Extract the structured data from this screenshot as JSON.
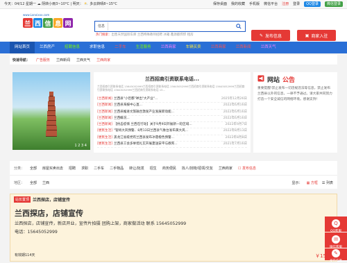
{
  "topbar": {
    "date": "今天：04/12 星期一",
    "weather1": "阴转小雨3~10°C | 明天：",
    "weather2": "多云转晴8~15°C",
    "links": [
      "保存桌面",
      "我的收藏",
      "手机版",
      "微信平台",
      "注册",
      "登录"
    ],
    "qq_label": "QQ登录",
    "wx_label": "微信登录"
  },
  "header": {
    "logo_url": "www.Lanxixxx.com",
    "logo_chars": [
      "兰",
      "西",
      "信",
      "息",
      "网"
    ],
    "search_select": "信息",
    "hot_label": "热门搜索：",
    "hot_terms": "出售天然国际车库 兰西特殊教师招聘 冰箱 鑫源都焊焊 租房",
    "post_button": "发布信息",
    "biz_button": "商家入驻"
  },
  "nav": {
    "items": [
      "网站首页",
      "兰西房产",
      "招聘信息",
      "求职信息",
      "二手车",
      "生活服务",
      "兰西商家",
      "车辆买卖",
      "兰西商家",
      "兰西新闻",
      "兰西天气"
    ]
  },
  "quick": {
    "label": "快速导航：",
    "items": [
      "广告服务",
      "兰西新闻",
      "兰西天气",
      "兰西商家"
    ]
  },
  "news": {
    "title": "兰西招商引资联系电话...",
    "subtitle": "兰西招商引资联系电话 15645052999兰西招商引资联系电话 15645052999兰西招商引资联系电话 15645052999兰西招商引资联系电话 15645052999兰西招商引资联系电话 15...",
    "items": [
      {
        "tag": "[兰西新闻]",
        "text": "兰西县\"小巨都\"禅出\"大产业\"...",
        "date": "2025年12月26日"
      },
      {
        "tag": "[兰西新闻]",
        "text": "兰西县海报中心直...",
        "date": "2022年6月16日"
      },
      {
        "tag": "[兰西新闻]",
        "text": "兰西县推进文旅融合激发产业发展新动能...",
        "date": "2022年6月16日"
      },
      {
        "tag": "[兰西新闻]",
        "text": "兰西概况...",
        "date": "2022年6月16日"
      },
      {
        "tag": "[兰西新闻]",
        "text": "【抗击疫情 兰西在行动】关于9月9日开展新一轮区域...",
        "date": "2022年9月7日"
      },
      {
        "tag": "[便民生活]",
        "text": "\"管将大风预警、8月13日兰西县气象台发布黄大风...",
        "date": "2022年8月13日"
      },
      {
        "tag": "[便民生活]",
        "text": "黑龙江省级党有兰西县发布冰雹橙色预警...",
        "date": "2022年8月8日"
      },
      {
        "tag": "[便民生活]",
        "text": "兰西县工会多举措扎实开展夏送安平与教育...",
        "date": "2021年7月16日"
      }
    ]
  },
  "notice": {
    "title_a": "网站",
    "title_b": "公告",
    "body": "重要提醒!禁止发布一切违规违法等信息，禁止发布兰西县以外的信息，一律不予通过。请大家共同努力打造一个安全诚信的网络环境。感谢支持！"
  },
  "slider": {
    "indicator": "1 2 3 4"
  },
  "category": {
    "label1": "分类：",
    "items": [
      "全部",
      "房屋买卖出去",
      "招聘",
      "求职",
      "二手车",
      "二手物品",
      "转让/批发",
      "招生",
      "商务便民",
      "找人/找物/招领/交友",
      "兰西商家"
    ],
    "extra": "发布信息",
    "label2": "地区：",
    "area_all": "全部",
    "area": "兰西",
    "display_label": "显示：",
    "display_grid": "方框",
    "display_list": "列表"
  },
  "listing": {
    "tag": "站长置顶",
    "head": "兰西探店，店铺宣传",
    "title": "兰西探店，店铺宣传",
    "desc": "兰西探店，店铺宣传，新店开业，宣传片拍摄 团购上架，商家做活动 联系 15645052999",
    "phone": "电话：15645052999",
    "valid": "有效期114天",
    "price": "￥1500"
  },
  "sidetools": [
    "QQ客服",
    "微信客服",
    "发布信息"
  ],
  "colors": {
    "primary": "#2a6fd6",
    "accent": "#e53935"
  }
}
